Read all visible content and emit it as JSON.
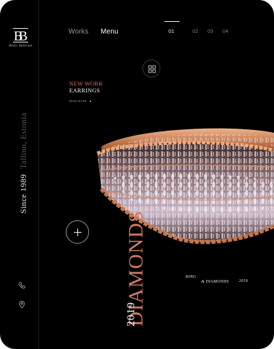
{
  "brand": {
    "subtitle": "Baltic Balticum"
  },
  "sidebar": {
    "city": "Tallinn, Estonia",
    "since": "Since 1989",
    "icons": [
      "phone-icon",
      "location-pin-icon"
    ]
  },
  "nav": {
    "works": "Works",
    "menu": "Menu"
  },
  "pager": {
    "pages": [
      "01",
      "02",
      "03",
      "04"
    ],
    "active": "01"
  },
  "feature": {
    "tag": "NEW WORK",
    "title": "EARRINGS",
    "read_more": "READ MORE"
  },
  "slide": {
    "title": "DIAMONDS",
    "year": "2019",
    "caption_line1": "RING",
    "caption_line2": "& DIAMONDS",
    "caption_year": "2019"
  },
  "colors": {
    "background": "#000000",
    "accent": "#d07a62",
    "text": "#ffffff",
    "muted": "#8a8a8a"
  }
}
